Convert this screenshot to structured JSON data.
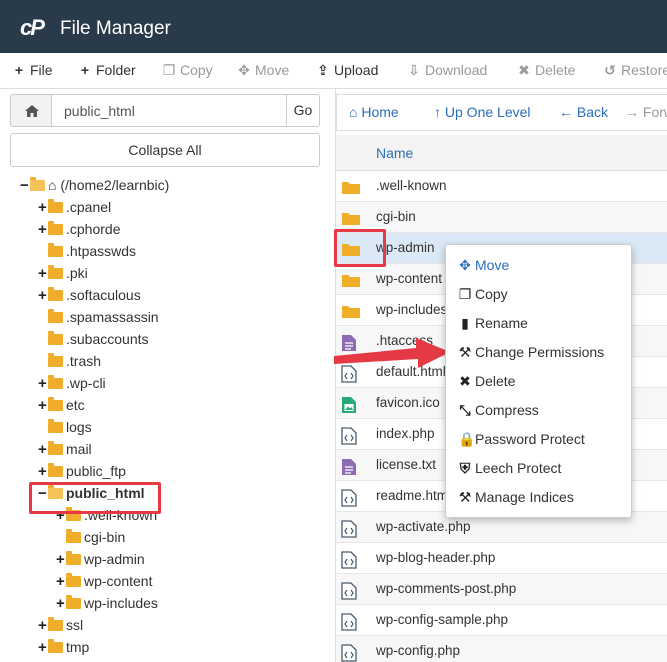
{
  "header": {
    "logo_text": "cP",
    "title": "File Manager"
  },
  "toolbar": {
    "file": "File",
    "folder": "Folder",
    "copy": "Copy",
    "move": "Move",
    "upload": "Upload",
    "download": "Download",
    "delete": "Delete",
    "restore": "Restore"
  },
  "left": {
    "path_value": "public_html",
    "go_label": "Go",
    "collapse_label": "Collapse All",
    "tree": [
      {
        "label": "(/home2/learnbic)",
        "pm": "−",
        "root": true
      },
      {
        "label": ".cpanel",
        "pm": "+"
      },
      {
        "label": ".cphorde",
        "pm": "+"
      },
      {
        "label": ".htpasswds",
        "pm": ""
      },
      {
        "label": ".pki",
        "pm": "+"
      },
      {
        "label": ".softaculous",
        "pm": "+"
      },
      {
        "label": ".spamassassin",
        "pm": ""
      },
      {
        "label": ".subaccounts",
        "pm": ""
      },
      {
        "label": ".trash",
        "pm": ""
      },
      {
        "label": ".wp-cli",
        "pm": "+"
      },
      {
        "label": "etc",
        "pm": "+"
      },
      {
        "label": "logs",
        "pm": ""
      },
      {
        "label": "mail",
        "pm": "+"
      },
      {
        "label": "public_ftp",
        "pm": "+"
      },
      {
        "label": "public_html",
        "pm": "−",
        "bold": true
      },
      {
        "label": ".well-known",
        "pm": "+"
      },
      {
        "label": "cgi-bin",
        "pm": ""
      },
      {
        "label": "wp-admin",
        "pm": "+"
      },
      {
        "label": "wp-content",
        "pm": "+"
      },
      {
        "label": "wp-includes",
        "pm": "+"
      },
      {
        "label": "ssl",
        "pm": "+"
      },
      {
        "label": "tmp",
        "pm": "+"
      }
    ]
  },
  "right": {
    "nav": {
      "home": "Home",
      "up": "Up One Level",
      "back": "Back",
      "forward": "Forward"
    },
    "column_name": "Name",
    "files": [
      {
        "name": ".well-known",
        "type": "folder"
      },
      {
        "name": "cgi-bin",
        "type": "folder"
      },
      {
        "name": "wp-admin",
        "type": "folder"
      },
      {
        "name": "wp-content",
        "type": "folder"
      },
      {
        "name": "wp-includes",
        "type": "folder"
      },
      {
        "name": ".htaccess",
        "type": "text"
      },
      {
        "name": "default.html",
        "type": "code"
      },
      {
        "name": "favicon.ico",
        "type": "image"
      },
      {
        "name": "index.php",
        "type": "code"
      },
      {
        "name": "license.txt",
        "type": "text"
      },
      {
        "name": "readme.html",
        "type": "code"
      },
      {
        "name": "wp-activate.php",
        "type": "code"
      },
      {
        "name": "wp-blog-header.php",
        "type": "code"
      },
      {
        "name": "wp-comments-post.php",
        "type": "code"
      },
      {
        "name": "wp-config-sample.php",
        "type": "code"
      },
      {
        "name": "wp-config.php",
        "type": "code"
      }
    ]
  },
  "context_menu": {
    "items": [
      {
        "label": "Move",
        "icon": "move-icon"
      },
      {
        "label": "Copy",
        "icon": "copy-icon"
      },
      {
        "label": "Rename",
        "icon": "file-icon"
      },
      {
        "label": "Change Permissions",
        "icon": "key-icon"
      },
      {
        "label": "Delete",
        "icon": "x-icon"
      },
      {
        "label": "Compress",
        "icon": "compress-icon"
      },
      {
        "label": "Password Protect",
        "icon": "lock-icon"
      },
      {
        "label": "Leech Protect",
        "icon": "shield-icon"
      },
      {
        "label": "Manage Indices",
        "icon": "wrench-icon"
      }
    ]
  },
  "colors": {
    "header_bg": "#293a4a",
    "link": "#2a6ebb",
    "folder": "#f0ad2a",
    "highlight": "#e53945",
    "selected_row": "#dbe8f5"
  }
}
